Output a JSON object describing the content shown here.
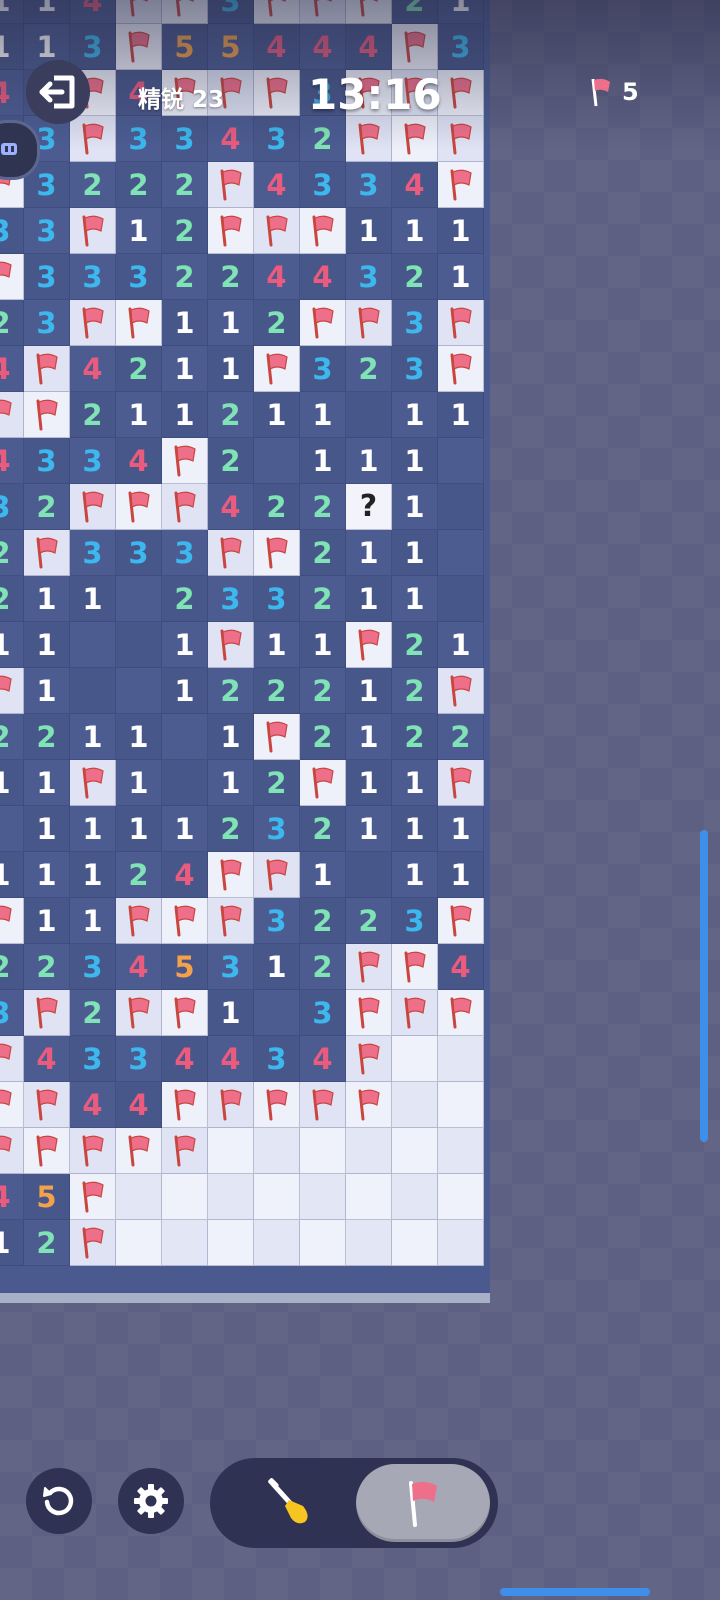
{
  "header": {
    "level_label": "精锐 23",
    "timer": "13:16",
    "flags_remaining": "5"
  },
  "board": {
    "rows": [
      [
        "1",
        "1",
        "4",
        "F",
        "F",
        "3",
        "F",
        "F",
        "F",
        "2",
        "1"
      ],
      [
        "1",
        "1",
        "3",
        "F",
        "5",
        "5",
        "4",
        "4",
        "4",
        "F",
        "3"
      ],
      [
        "4",
        "4",
        "F",
        "4",
        "F",
        "F",
        "F",
        "3",
        "F",
        "F",
        "F"
      ],
      [
        "3",
        "3",
        "F",
        "3",
        "3",
        "4",
        "3",
        "2",
        "F",
        "F",
        "F"
      ],
      [
        "F",
        "3",
        "2",
        "2",
        "2",
        "F",
        "4",
        "3",
        "3",
        "4",
        "F"
      ],
      [
        "3",
        "3",
        "F",
        "1",
        "2",
        "F",
        "F",
        "F",
        "1",
        "1",
        "1"
      ],
      [
        "F",
        "3",
        "3",
        "3",
        "2",
        "2",
        "4",
        "4",
        "3",
        "2",
        "1"
      ],
      [
        "2",
        "3",
        "F",
        "F",
        "1",
        "1",
        "2",
        "F",
        "F",
        "3",
        "F"
      ],
      [
        "4",
        "F",
        "4",
        "2",
        "1",
        "1",
        "F",
        "3",
        "2",
        "3",
        "F"
      ],
      [
        "F",
        "F",
        "2",
        "1",
        "1",
        "2",
        "1",
        "1",
        "",
        "1",
        "1"
      ],
      [
        "4",
        "3",
        "3",
        "4",
        "F",
        "2",
        "",
        "1",
        "1",
        "1",
        ""
      ],
      [
        "3",
        "2",
        "F",
        "F",
        "F",
        "4",
        "2",
        "2",
        "?",
        "1",
        ""
      ],
      [
        "2",
        "F",
        "3",
        "3",
        "3",
        "F",
        "F",
        "2",
        "1",
        "1",
        ""
      ],
      [
        "2",
        "1",
        "1",
        "",
        "2",
        "3",
        "3",
        "2",
        "1",
        "1",
        ""
      ],
      [
        "1",
        "1",
        "",
        "",
        "1",
        "F",
        "1",
        "1",
        "F",
        "2",
        "1"
      ],
      [
        "F",
        "1",
        "",
        "",
        "1",
        "2",
        "2",
        "2",
        "1",
        "2",
        "F"
      ],
      [
        "2",
        "2",
        "1",
        "1",
        "",
        "1",
        "F",
        "2",
        "1",
        "2",
        "2"
      ],
      [
        "1",
        "1",
        "F",
        "1",
        "",
        "1",
        "2",
        "F",
        "1",
        "1",
        "F"
      ],
      [
        "",
        "1",
        "1",
        "1",
        "1",
        "2",
        "3",
        "2",
        "1",
        "1",
        "1"
      ],
      [
        "1",
        "1",
        "1",
        "2",
        "4",
        "F",
        "F",
        "1",
        "",
        "1",
        "1"
      ],
      [
        "F",
        "1",
        "1",
        "F",
        "F",
        "F",
        "3",
        "2",
        "2",
        "3",
        "F"
      ],
      [
        "2",
        "2",
        "3",
        "4",
        "5",
        "3",
        "1",
        "2",
        "F",
        "F",
        "4"
      ],
      [
        "3",
        "F",
        "2",
        "F",
        "F",
        "1",
        "",
        "3",
        "F",
        "F",
        "F"
      ],
      [
        "F",
        "4",
        "3",
        "3",
        "4",
        "4",
        "3",
        "4",
        "F",
        "H",
        "H"
      ],
      [
        "F",
        "F",
        "4",
        "4",
        "F",
        "F",
        "F",
        "F",
        "F",
        "H",
        "H"
      ],
      [
        "F",
        "F",
        "F",
        "F",
        "F",
        "H",
        "H",
        "H",
        "H",
        "H",
        "H"
      ],
      [
        "4",
        "5",
        "F",
        "H",
        "H",
        "H",
        "H",
        "H",
        "H",
        "H",
        "H"
      ],
      [
        "1",
        "2",
        "F",
        "H",
        "H",
        "H",
        "H",
        "H",
        "H",
        "H",
        "H"
      ]
    ]
  },
  "colors": {
    "n1": "#ffffff",
    "n2": "#7fe3b5",
    "n3": "#3cb8ee",
    "n4": "#ea5b7e",
    "n5": "#f4a24a",
    "flag": "#ee6f8a",
    "accent": "#3f8fea"
  },
  "icons": {
    "exit": "exit-icon",
    "restart": "restart-icon",
    "settings": "gear-icon",
    "dig": "shovel-icon",
    "flag": "flag-icon"
  },
  "toolbar": {
    "selected_tool": "flag"
  }
}
